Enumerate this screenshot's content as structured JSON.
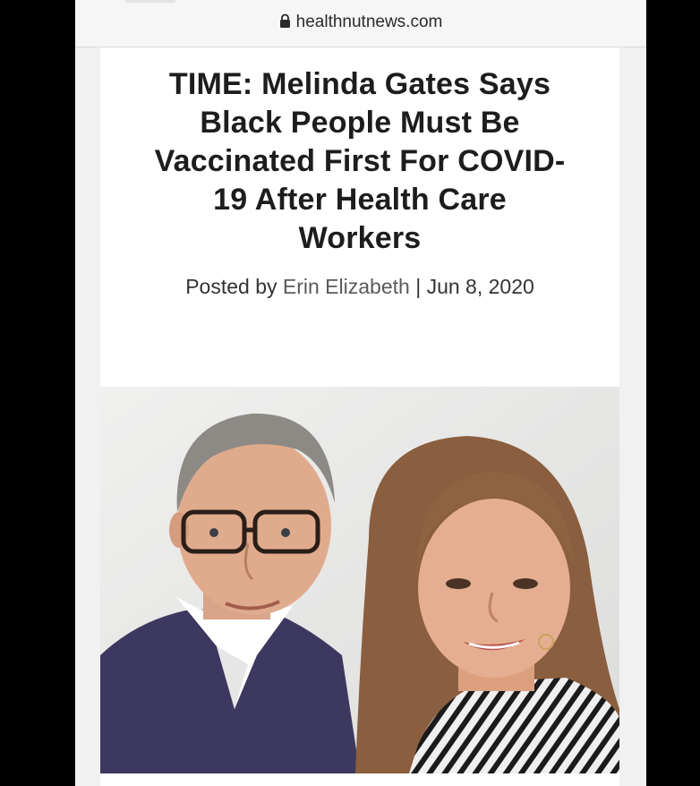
{
  "browser": {
    "url": "healthnutnews.com",
    "lock_icon": "lock-icon"
  },
  "article": {
    "title_lines": [
      "TIME: Melinda Gates Says",
      "Black People Must Be",
      "Vaccinated First For COVID-",
      "19 After Health Care",
      "Workers"
    ],
    "posted_by_prefix": "Posted by",
    "author": "Erin Elizabeth",
    "separator": "|",
    "date": "Jun 8, 2020"
  },
  "colors": {
    "page_background": "#000000",
    "content_background": "#ffffff",
    "title_text": "#1d1d1d"
  }
}
